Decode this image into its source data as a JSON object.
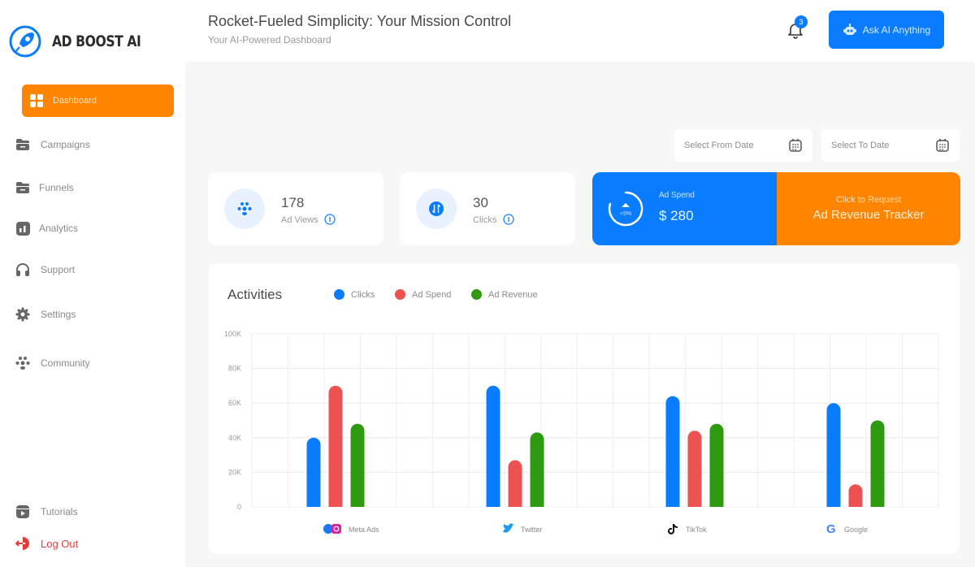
{
  "brand": {
    "name": "AD BOOST AI",
    "logo_icon": "rocket-icon"
  },
  "sidebar": {
    "items": [
      {
        "label": "Dashboard",
        "icon": "grid-icon",
        "active": true
      },
      {
        "label": "Campaigns",
        "icon": "folder-icon"
      },
      {
        "label": "Funnels",
        "icon": "folder-icon"
      },
      {
        "label": "Analytics",
        "icon": "bar-chart-icon"
      },
      {
        "label": "Support",
        "icon": "headphones-icon"
      },
      {
        "label": "Settings",
        "icon": "gear-icon"
      },
      {
        "label": "Community",
        "icon": "community-icon"
      }
    ],
    "bottom": [
      {
        "label": "Tutorials",
        "icon": "video-icon"
      },
      {
        "label": "Log Out",
        "icon": "logout-icon"
      }
    ]
  },
  "header": {
    "title": "Rocket-Fueled Simplicity: Your Mission Control",
    "subtitle": "Your AI-Powered Dashboard",
    "notification_count": "3",
    "ask_button": "Ask AI Anything"
  },
  "filters": {
    "from_placeholder": "Select From Date",
    "to_placeholder": "Select To Date"
  },
  "stats": {
    "ad_views": {
      "value": "178",
      "label": "Ad Views"
    },
    "clicks": {
      "value": "30",
      "label": "Clicks"
    },
    "ad_spend": {
      "label": "Ad Spend",
      "value": "$ 280",
      "change": "+5%"
    },
    "revenue_tracker": {
      "line1": "Click to Request",
      "line2": "Ad Revenue Tracker"
    }
  },
  "colors": {
    "primary": "#0a7cff",
    "accent": "#ff8500",
    "clicks": "#0a7cff",
    "ad_spend": "#ec5252",
    "ad_revenue": "#2d9a10"
  },
  "chart_data": {
    "type": "bar",
    "title": "Activities",
    "categories": [
      "Meta Ads",
      "Twitter",
      "TikTok",
      "Google"
    ],
    "category_icons": [
      "meta-icon",
      "twitter-icon",
      "tiktok-icon",
      "google-icon"
    ],
    "series": [
      {
        "name": "Clicks",
        "color": "#0a7cff",
        "values": [
          40000,
          70000,
          64000,
          60000
        ]
      },
      {
        "name": "Ad Spend",
        "color": "#ec5252",
        "values": [
          70000,
          27000,
          44000,
          13000
        ]
      },
      {
        "name": "Ad Revenue",
        "color": "#2d9a10",
        "values": [
          48000,
          43000,
          48000,
          50000
        ]
      }
    ],
    "yticks": [
      "0",
      "20K",
      "40K",
      "60K",
      "80K",
      "100K"
    ],
    "ylim": [
      0,
      100000
    ],
    "xlabel": "",
    "ylabel": "",
    "grid": true,
    "legend_position": "top"
  }
}
